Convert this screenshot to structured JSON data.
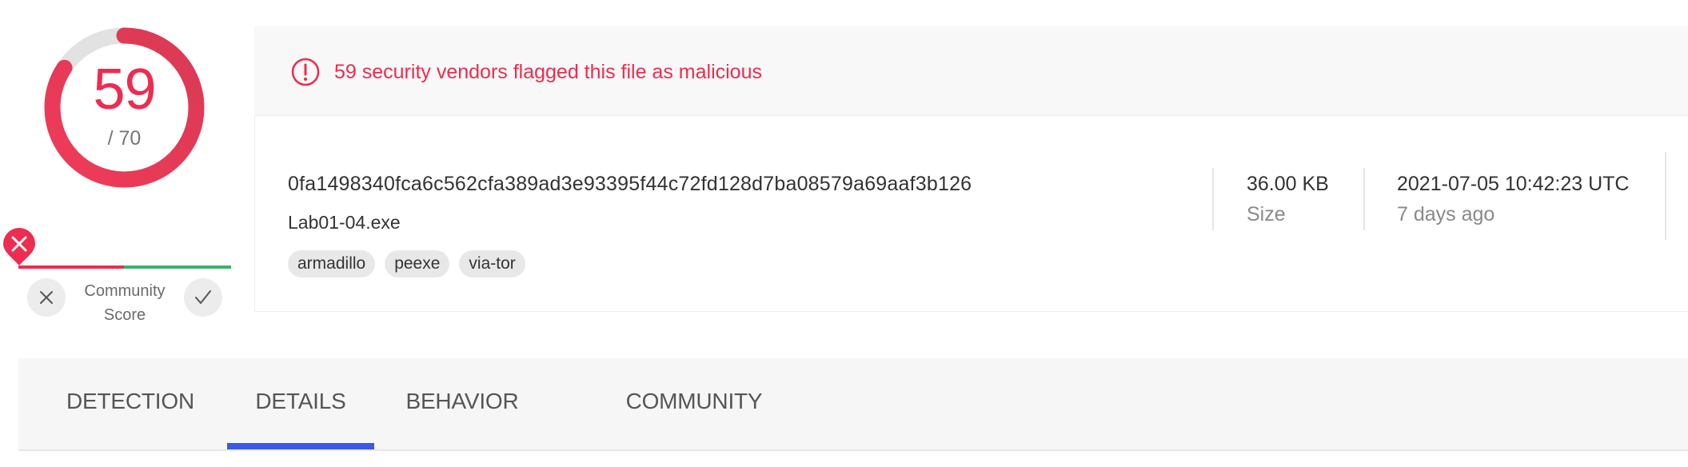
{
  "score": {
    "detections": "59",
    "total": "/ 70",
    "detections_count": 59,
    "engines_total": 70,
    "color": "#ee2c4f"
  },
  "community": {
    "label_line1": "Community",
    "label_line2": "Score",
    "marker_icon": "close-icon",
    "downvote_icon": "close-icon",
    "upvote_icon": "check-icon",
    "negative_color": "#ee2c4f",
    "positive_color": "#3ab26c"
  },
  "alert": {
    "icon": "exclamation-circle-icon",
    "text": "59 security vendors flagged this file as malicious",
    "color": "#ee2c4f"
  },
  "file": {
    "hash": "0fa1498340fca6c562cfa389ad3e93395f44c72fd128d7ba08579a69aaf3b126",
    "name": "Lab01-04.exe",
    "tags": [
      "armadillo",
      "peexe",
      "via-tor"
    ],
    "size": {
      "value": "36.00 KB",
      "label": "Size"
    },
    "date": {
      "value": "2021-07-05 10:42:23 UTC",
      "label": "7 days ago"
    }
  },
  "tabs": {
    "detection": "DETECTION",
    "details": "DETAILS",
    "behavior": "BEHAVIOR",
    "community": "COMMUNITY",
    "active": "DETAILS",
    "active_color": "#3b58e6"
  }
}
